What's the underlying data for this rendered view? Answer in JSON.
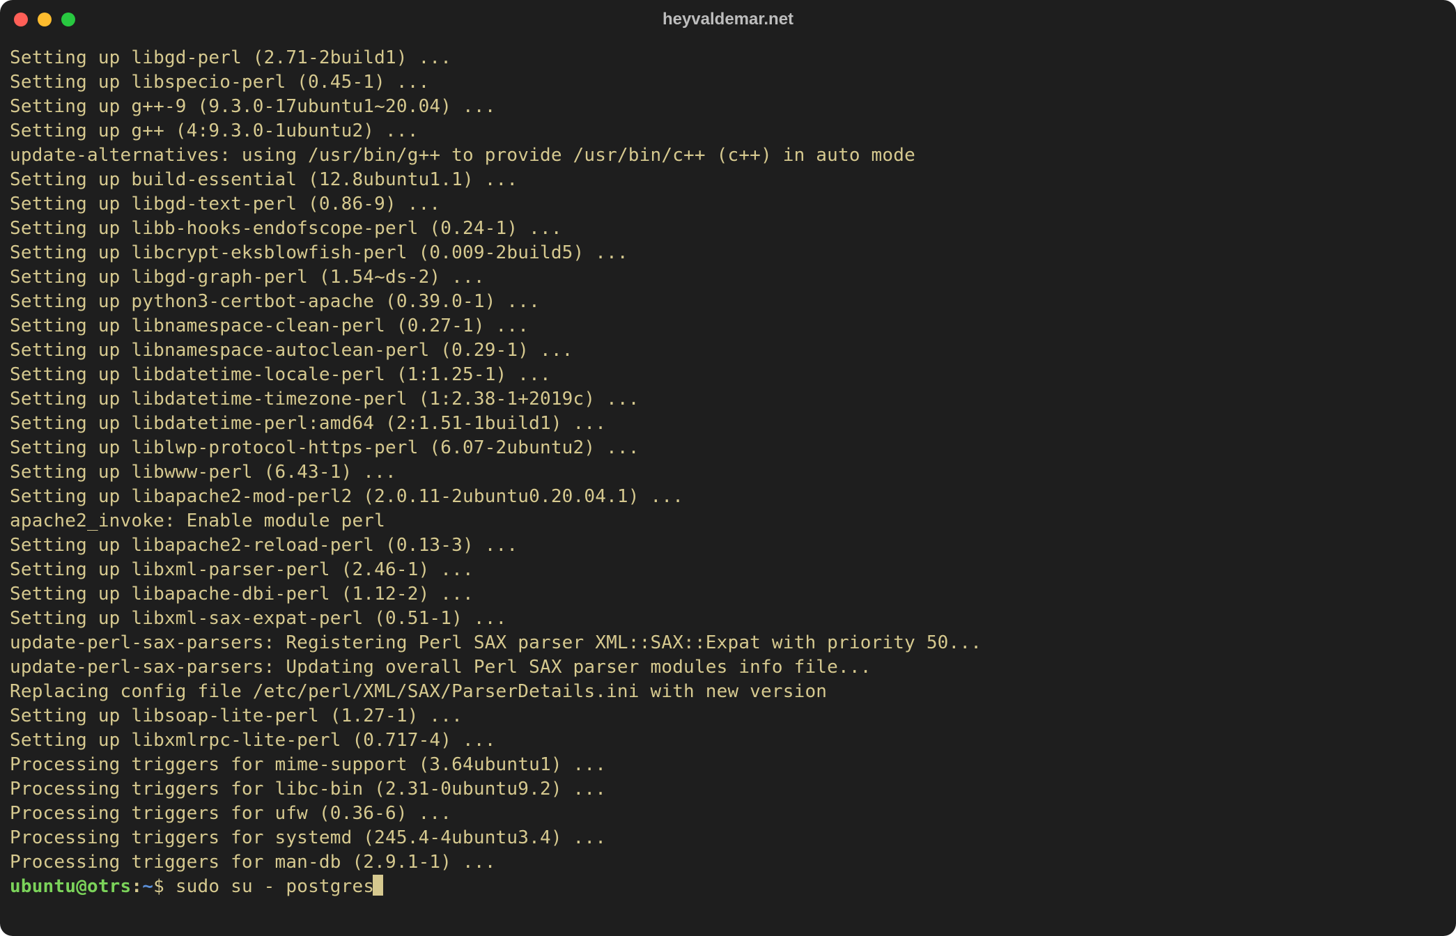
{
  "window": {
    "title": "heyvaldemar.net"
  },
  "terminal": {
    "lines": [
      "Setting up libgd-perl (2.71-2build1) ...",
      "Setting up libspecio-perl (0.45-1) ...",
      "Setting up g++-9 (9.3.0-17ubuntu1~20.04) ...",
      "Setting up g++ (4:9.3.0-1ubuntu2) ...",
      "update-alternatives: using /usr/bin/g++ to provide /usr/bin/c++ (c++) in auto mode",
      "Setting up build-essential (12.8ubuntu1.1) ...",
      "Setting up libgd-text-perl (0.86-9) ...",
      "Setting up libb-hooks-endofscope-perl (0.24-1) ...",
      "Setting up libcrypt-eksblowfish-perl (0.009-2build5) ...",
      "Setting up libgd-graph-perl (1.54~ds-2) ...",
      "Setting up python3-certbot-apache (0.39.0-1) ...",
      "Setting up libnamespace-clean-perl (0.27-1) ...",
      "Setting up libnamespace-autoclean-perl (0.29-1) ...",
      "Setting up libdatetime-locale-perl (1:1.25-1) ...",
      "Setting up libdatetime-timezone-perl (1:2.38-1+2019c) ...",
      "Setting up libdatetime-perl:amd64 (2:1.51-1build1) ...",
      "Setting up liblwp-protocol-https-perl (6.07-2ubuntu2) ...",
      "Setting up libwww-perl (6.43-1) ...",
      "Setting up libapache2-mod-perl2 (2.0.11-2ubuntu0.20.04.1) ...",
      "apache2_invoke: Enable module perl",
      "Setting up libapache2-reload-perl (0.13-3) ...",
      "Setting up libxml-parser-perl (2.46-1) ...",
      "Setting up libapache-dbi-perl (1.12-2) ...",
      "Setting up libxml-sax-expat-perl (0.51-1) ...",
      "update-perl-sax-parsers: Registering Perl SAX parser XML::SAX::Expat with priority 50...",
      "update-perl-sax-parsers: Updating overall Perl SAX parser modules info file...",
      "Replacing config file /etc/perl/XML/SAX/ParserDetails.ini with new version",
      "Setting up libsoap-lite-perl (1.27-1) ...",
      "Setting up libxmlrpc-lite-perl (0.717-4) ...",
      "Processing triggers for mime-support (3.64ubuntu1) ...",
      "Processing triggers for libc-bin (2.31-0ubuntu9.2) ...",
      "Processing triggers for ufw (0.36-6) ...",
      "Processing triggers for systemd (245.4-4ubuntu3.4) ...",
      "Processing triggers for man-db (2.9.1-1) ..."
    ],
    "prompt": {
      "user_host": "ubuntu@otrs",
      "separator": ":",
      "path": "~",
      "symbol": "$",
      "command": "sudo su - postgres"
    }
  }
}
